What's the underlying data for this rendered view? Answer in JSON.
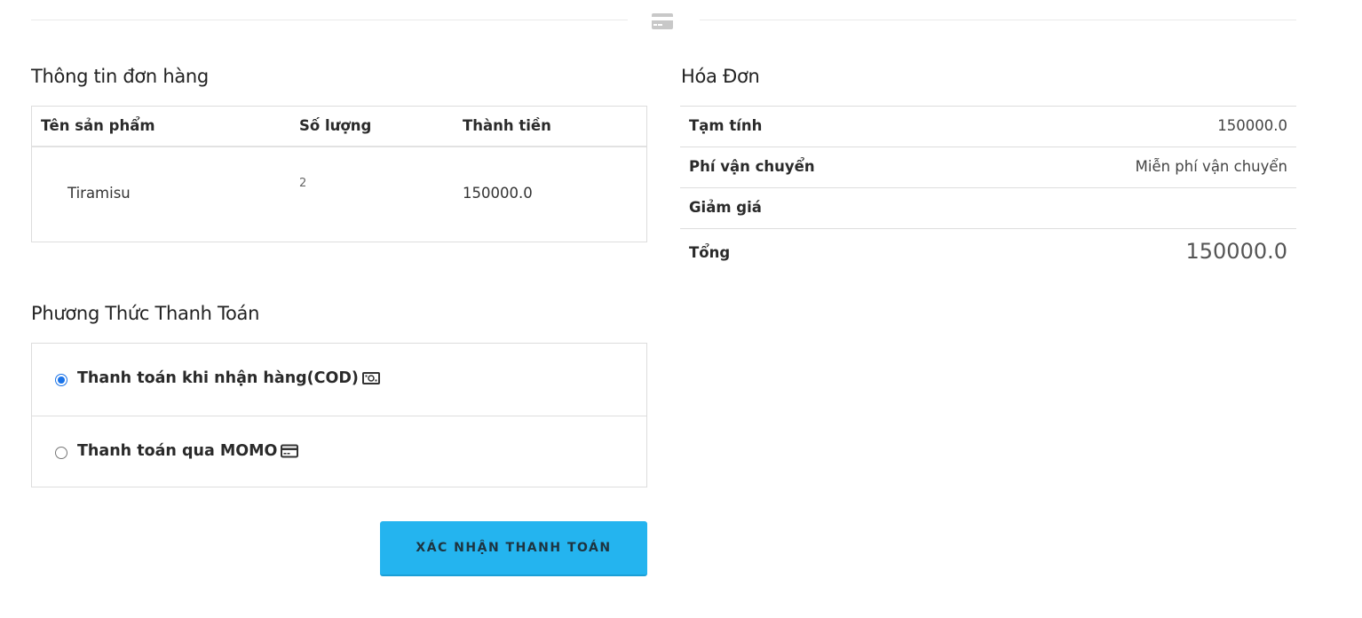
{
  "order": {
    "title": "Thông tin đơn hàng",
    "columns": {
      "name": "Tên sản phẩm",
      "quantity": "Số lượng",
      "total": "Thành tiền"
    },
    "items": [
      {
        "name": "Tiramisu",
        "quantity": "2",
        "total": "150000.0"
      }
    ]
  },
  "invoice": {
    "title": "Hóa Đơn",
    "subtotal_label": "Tạm tính",
    "subtotal_value": "150000.0",
    "shipping_label": "Phí vận chuyển",
    "shipping_value": "Miễn phí vận chuyển",
    "discount_label": "Giảm giá",
    "discount_value": "",
    "total_label": "Tổng",
    "total_value": "150000.0"
  },
  "payment": {
    "title": "Phương Thức Thanh Toán",
    "options": [
      {
        "label": "Thanh toán khi nhận hàng(COD)",
        "icon": "cash-icon",
        "selected": true
      },
      {
        "label": "Thanh toán qua MOMO",
        "icon": "credit-card-icon",
        "selected": false
      }
    ]
  },
  "confirm_button": {
    "label": "XÁC NHẬN THANH TOÁN",
    "color": "#24b4ef"
  },
  "colors": {
    "accent": "#24b4ef",
    "radio_selected": "#1a73e8"
  }
}
